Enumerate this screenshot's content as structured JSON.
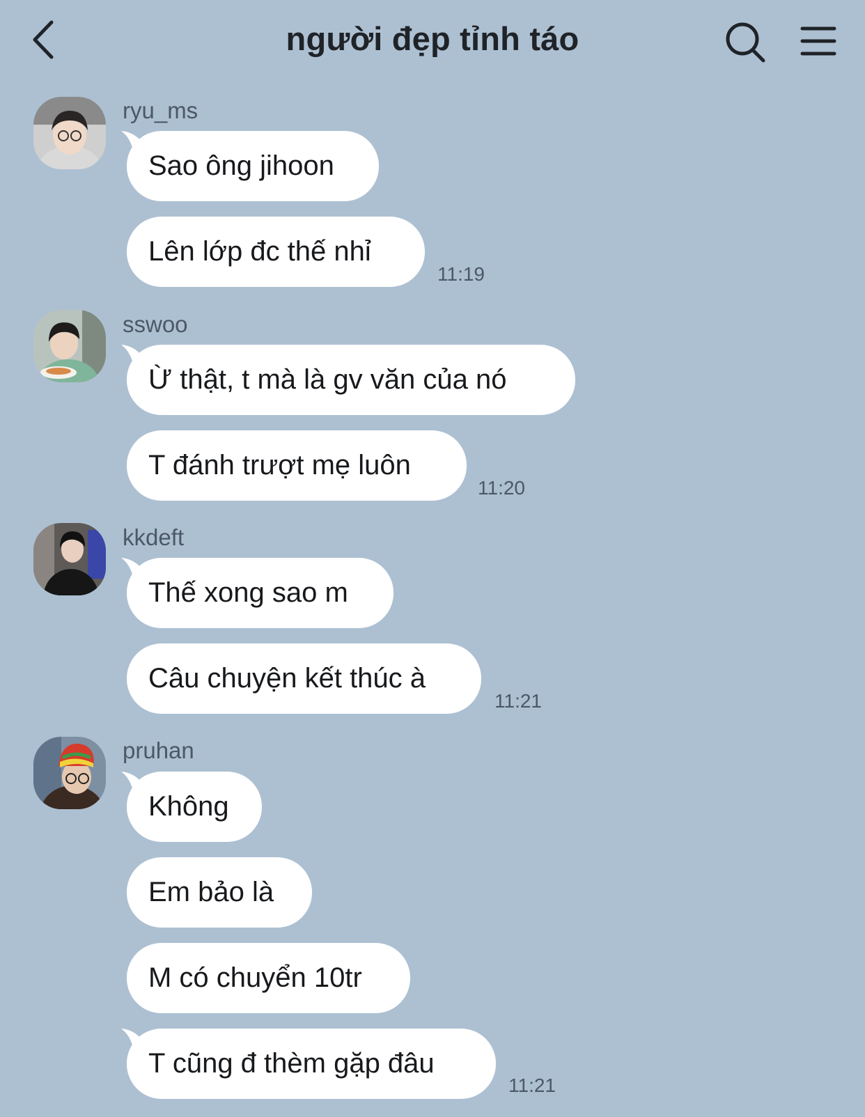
{
  "header": {
    "title": "người đẹp tỉnh táo"
  },
  "groups": [
    {
      "sender": "ryu_ms",
      "time": "11:19",
      "messages": [
        "Sao ông jihoon",
        "Lên lớp đc thế nhỉ"
      ]
    },
    {
      "sender": "sswoo",
      "time": "11:20",
      "messages": [
        "Ừ thật, t mà là gv văn của nó",
        "T đánh trượt mẹ luôn"
      ]
    },
    {
      "sender": "kkdeft",
      "time": "11:21",
      "messages": [
        "Thế xong sao m",
        "Câu chuyện kết thúc à"
      ]
    },
    {
      "sender": "pruhan",
      "time": "11:21",
      "messages": [
        "Không",
        "Em bảo là",
        "M có chuyển 10tr",
        "T cũng đ thèm gặp đâu"
      ]
    }
  ],
  "colors": {
    "background": "#adc0d2",
    "bubble": "#ffffff",
    "meta_text": "#4c5866"
  },
  "icons": [
    "back-arrow-icon",
    "search-icon",
    "menu-icon"
  ]
}
